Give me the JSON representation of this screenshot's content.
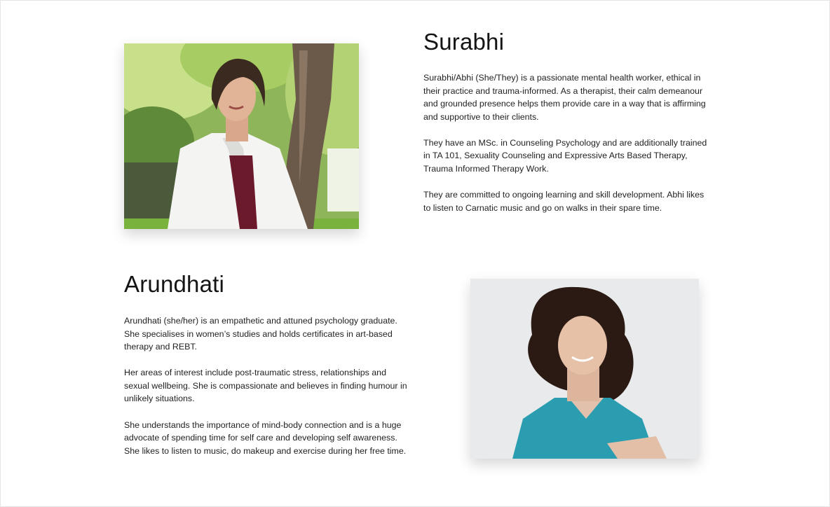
{
  "profiles": [
    {
      "name": "Surabhi",
      "paragraphs": [
        "Surabhi/Abhi (She/They) is a passionate mental health worker, ethical in their practice and  trauma-informed. As a therapist, their calm demeanour and grounded presence helps them  provide care in a way that is affirming and supportive to their clients.",
        "They have an MSc. in Counseling Psychology and are additionally trained in TA 101, Sexuality  Counseling and Expressive Arts Based Therapy, Trauma Informed Therapy Work.",
        "They are  committed to ongoing learning and skill development.  Abhi likes to listen to Carnatic music and go on walks in their spare time."
      ]
    },
    {
      "name": "Arundhati",
      "paragraphs": [
        "Arundhati (she/her) is an empathetic and attuned psychology graduate. She specialises in women’s studies and holds certificates in art-based therapy and REBT.",
        "Her areas of interest include post-traumatic stress, relationships and sexual wellbeing. She is compassionate and believes in finding humour in unlikely situations.",
        "She understands the importance of mind-body connection and is a huge advocate of spending time for self care and developing self awareness. She likes to listen to music, do makeup and exercise during her free time."
      ]
    }
  ]
}
